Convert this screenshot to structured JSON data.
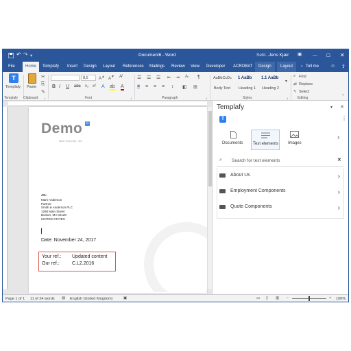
{
  "titlebar": {
    "save_icon": "save-icon",
    "undo_icon": "undo-icon",
    "title": "Document6 - Word",
    "user_fragment": "Sebl...",
    "user": "Jens Kjær"
  },
  "tabs": [
    "File",
    "Home",
    "Templafy",
    "Insert",
    "Design",
    "Layout",
    "References",
    "Mailings",
    "Review",
    "View",
    "Developer",
    "ACROBAT",
    "Design",
    "Layout"
  ],
  "tell_me": "Tell me",
  "ribbon": {
    "templafy_btn": "Templafy",
    "paste_btn": "Paste",
    "font_size": "8,5",
    "styles": [
      {
        "preview": "AaBbCcDc",
        "name": "Body Text"
      },
      {
        "preview": "1 AaBb",
        "name": "Heading 1"
      },
      {
        "preview": "1.1 AaBb",
        "name": "Heading 2"
      }
    ],
    "find": "Find",
    "replace": "Replace",
    "select": "Select",
    "groups": [
      "Templafy",
      "Clipboard",
      "Font",
      "Paragraph",
      "Styles",
      "Editing"
    ]
  },
  "document": {
    "logo": "Demo",
    "logo_badge": "0",
    "logo_sub": "New York City - DC",
    "att_label": "Att.:",
    "address": [
      "Mark Anderson",
      "Partner",
      "Smith & Anderson PLC",
      "1288 Main Street",
      "Boston, MA 02128",
      "UNITED STATES"
    ],
    "date_line": "Date: November 24, 2017",
    "your_ref_label": "Your ref.:",
    "your_ref_value": "Updated content",
    "our_ref_label": "Our ref.:",
    "our_ref_value": "C.L2.2016"
  },
  "pane": {
    "title": "Templafy",
    "tabs": [
      "Documents",
      "Text elements",
      "Images"
    ],
    "search_placeholder": "Search for text elements",
    "items": [
      "About Us",
      "Employment Components",
      "Quote Components"
    ]
  },
  "status": {
    "page": "Page 1 of 1",
    "words": "11 of 24 words",
    "language": "English (United Kingdom)",
    "zoom": "100%"
  },
  "colors": {
    "accent": "#2b579a",
    "templafy": "#2f80ed",
    "highlight": "#d9534f"
  }
}
